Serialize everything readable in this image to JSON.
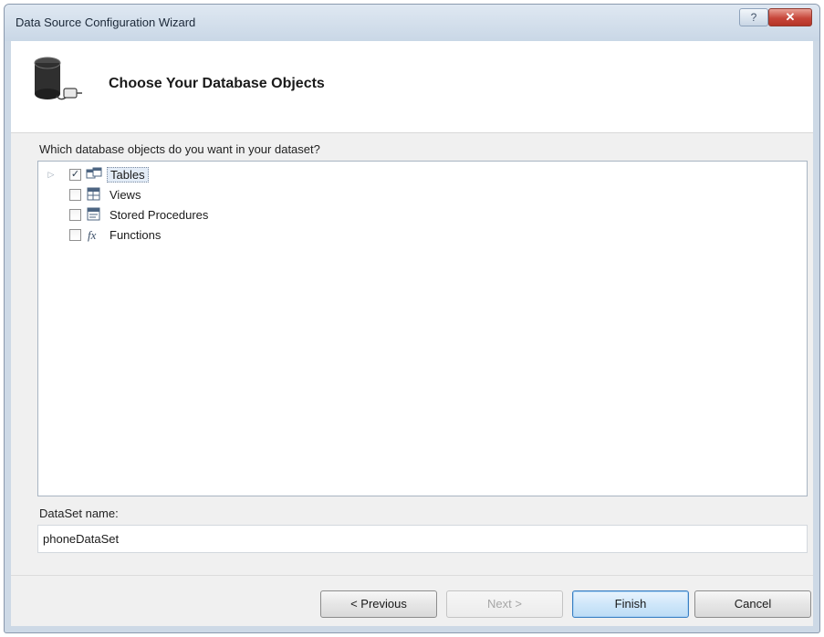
{
  "window": {
    "title": "Data Source Configuration Wizard",
    "help_glyph": "?",
    "close_glyph": "✕"
  },
  "header": {
    "heading": "Choose Your Database Objects",
    "icon": "database-icon"
  },
  "tree": {
    "prompt": "Which database objects do you want in your dataset?",
    "items": [
      {
        "label": "Tables",
        "checked": true,
        "expandable": true,
        "selected": true,
        "icon": "table-icon"
      },
      {
        "label": "Views",
        "checked": false,
        "expandable": false,
        "selected": false,
        "icon": "view-icon"
      },
      {
        "label": "Stored Procedures",
        "checked": false,
        "expandable": false,
        "selected": false,
        "icon": "stored-procedure-icon"
      },
      {
        "label": "Functions",
        "checked": false,
        "expandable": false,
        "selected": false,
        "icon": "function-icon"
      }
    ],
    "check_glyph": "✓",
    "expander_glyph": "▷"
  },
  "dataset": {
    "label": "DataSet name:",
    "value": "phoneDataSet"
  },
  "buttons": {
    "previous": "< Previous",
    "next": "Next >",
    "finish": "Finish",
    "cancel": "Cancel"
  },
  "colors": {
    "client_bg": "#f0f0f0",
    "frame": "#cdd9e6",
    "close_red": "#c7463a",
    "default_button": "#3b7fc2"
  }
}
